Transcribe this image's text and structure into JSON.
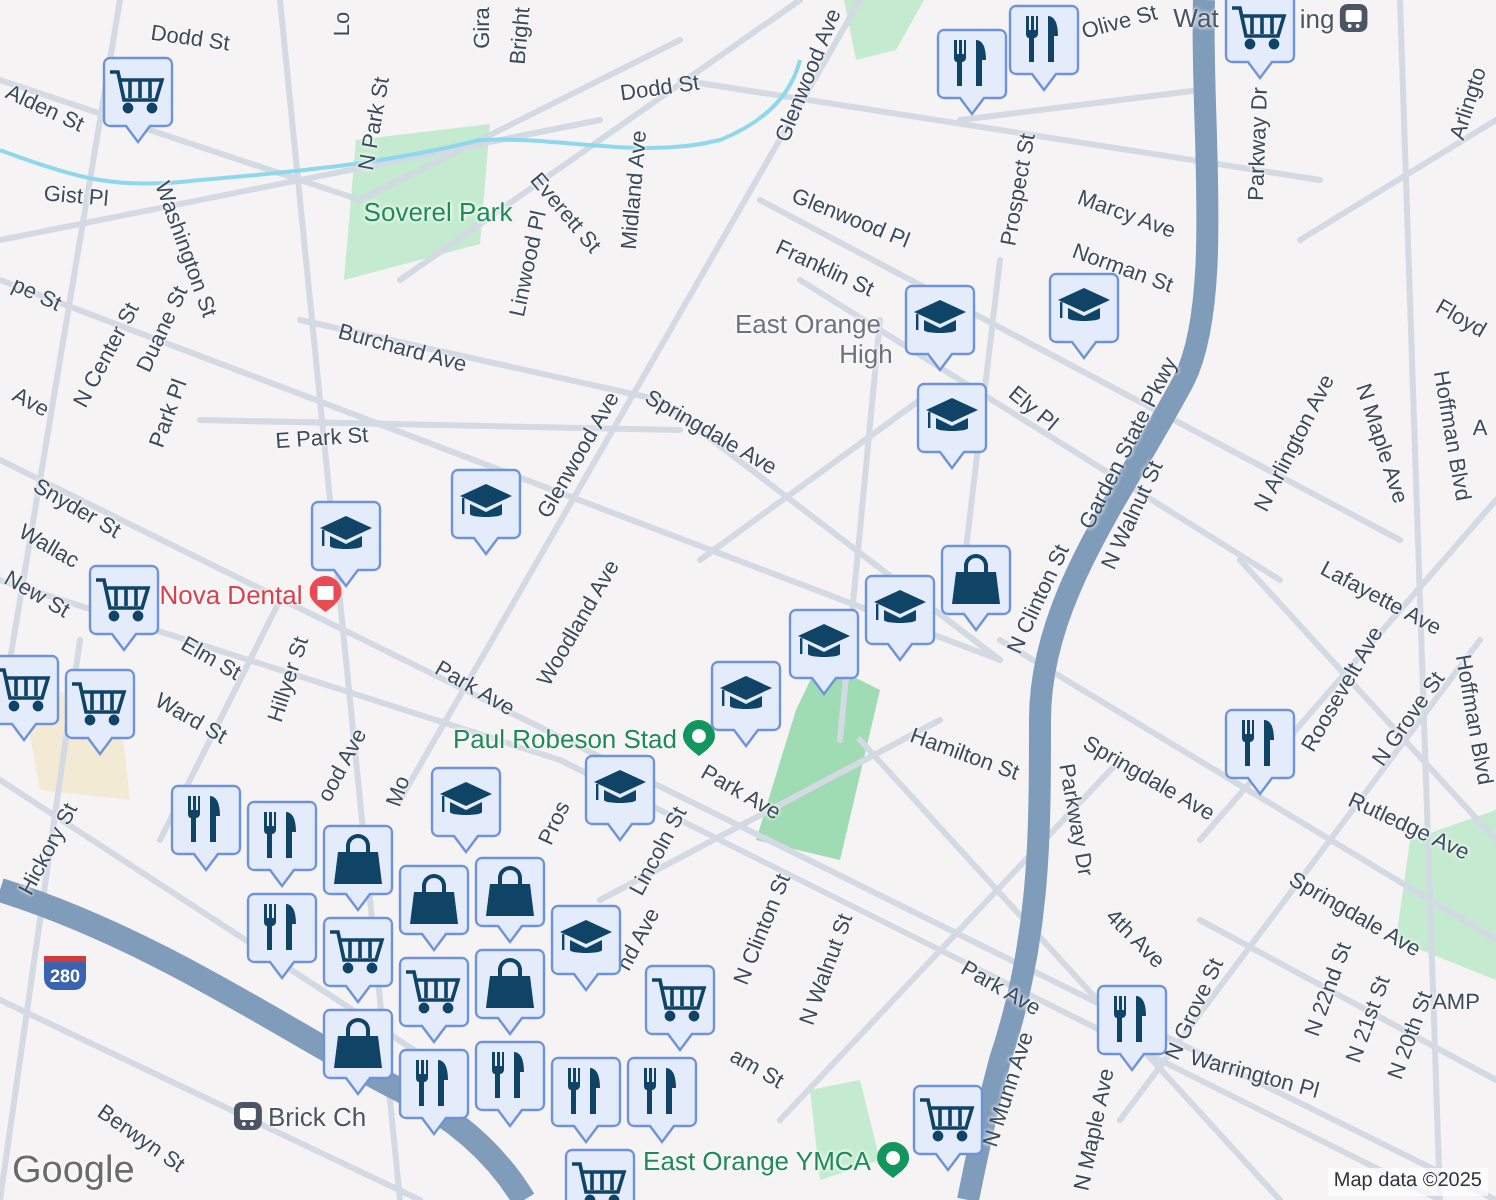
{
  "streets": [
    "Dodd St",
    "Dodd St",
    "Lo",
    "Gira",
    "Bright",
    "Alden St",
    "Gist Pl",
    "N Park St",
    "Washington St",
    "Everett St",
    "Linwood Pl",
    "Midland Ave",
    "pe St",
    "N Center St",
    "Duane St",
    "Burchard Ave",
    "Park Pl",
    "Ave",
    "E Park St",
    "Glenwood Ave",
    "Glenwood Ave",
    "Springdale Ave",
    "Olive St",
    "Glenwood Pl",
    "Franklin St",
    "Prospect St",
    "Marcy Ave",
    "Norman St",
    "Ely Pl",
    "Garden State Pkwy",
    "N Walnut St",
    "Parkway Dr",
    "Arlingto",
    "Floyd",
    "N Arlington Ave",
    "N Maple Ave",
    "Hoffman Blvd",
    "A",
    "Snyder St",
    "Woodland Ave",
    "Wallac",
    "N Clinton St",
    "Lafayette Ave",
    "New St",
    "Elm St",
    "Ward St",
    "Hillyer St",
    "Park Ave",
    "Roosevelt Ave",
    "N Grove St",
    "Hoffman Blvd",
    "Hamilton St",
    "Springdale Ave",
    "Rutledge Ave",
    "ood Ave",
    "Park Ave",
    "Pros",
    "Lincoln St",
    "Mo",
    "Hickory St",
    "Parkway Dr",
    "Springdale Ave",
    "N Clinton St",
    "4th Ave",
    "nd Ave",
    "N Walnut St",
    "Park Ave",
    "N 22nd St",
    "N 21st St",
    "N 20th St",
    "N Grove St",
    "Warrington Pl",
    "am St",
    "N Munn Ave",
    "N Maple Ave",
    "Berwyn St",
    "AMP"
  ],
  "places": [
    {
      "name": "Soverel Park",
      "kind": "park"
    },
    {
      "name": "East Orange",
      "kind": "school"
    },
    {
      "name": "High",
      "kind": "school"
    },
    {
      "name": "Nova Dental",
      "kind": "dental"
    },
    {
      "name": "Paul Robeson Stad",
      "kind": "park-pin"
    },
    {
      "name": "East Orange YMCA",
      "kind": "park-pin"
    },
    {
      "name": "Brick Ch",
      "kind": "station"
    },
    {
      "name": "Wat",
      "kind": "plain"
    },
    {
      "name": "ing",
      "kind": "station-end"
    }
  ],
  "highway_shield": "280",
  "markers": [
    {
      "kind": "grocery"
    },
    {
      "kind": "restaurant"
    },
    {
      "kind": "restaurant"
    },
    {
      "kind": "grocery"
    },
    {
      "kind": "school"
    },
    {
      "kind": "school"
    },
    {
      "kind": "school"
    },
    {
      "kind": "school"
    },
    {
      "kind": "school"
    },
    {
      "kind": "shopping"
    },
    {
      "kind": "school"
    },
    {
      "kind": "school"
    },
    {
      "kind": "grocery"
    },
    {
      "kind": "grocery"
    },
    {
      "kind": "grocery"
    },
    {
      "kind": "school"
    },
    {
      "kind": "school"
    },
    {
      "kind": "restaurant"
    },
    {
      "kind": "school"
    },
    {
      "kind": "restaurant"
    },
    {
      "kind": "restaurant"
    },
    {
      "kind": "restaurant"
    },
    {
      "kind": "shopping"
    },
    {
      "kind": "shopping"
    },
    {
      "kind": "shopping"
    },
    {
      "kind": "school"
    },
    {
      "kind": "grocery"
    },
    {
      "kind": "grocery"
    },
    {
      "kind": "shopping"
    },
    {
      "kind": "shopping"
    },
    {
      "kind": "restaurant"
    },
    {
      "kind": "restaurant"
    },
    {
      "kind": "grocery"
    },
    {
      "kind": "restaurant"
    },
    {
      "kind": "restaurant"
    },
    {
      "kind": "restaurant"
    },
    {
      "kind": "grocery"
    },
    {
      "kind": "grocery"
    }
  ],
  "attribution": {
    "logo": "Google",
    "data": "Map data ©2025"
  }
}
